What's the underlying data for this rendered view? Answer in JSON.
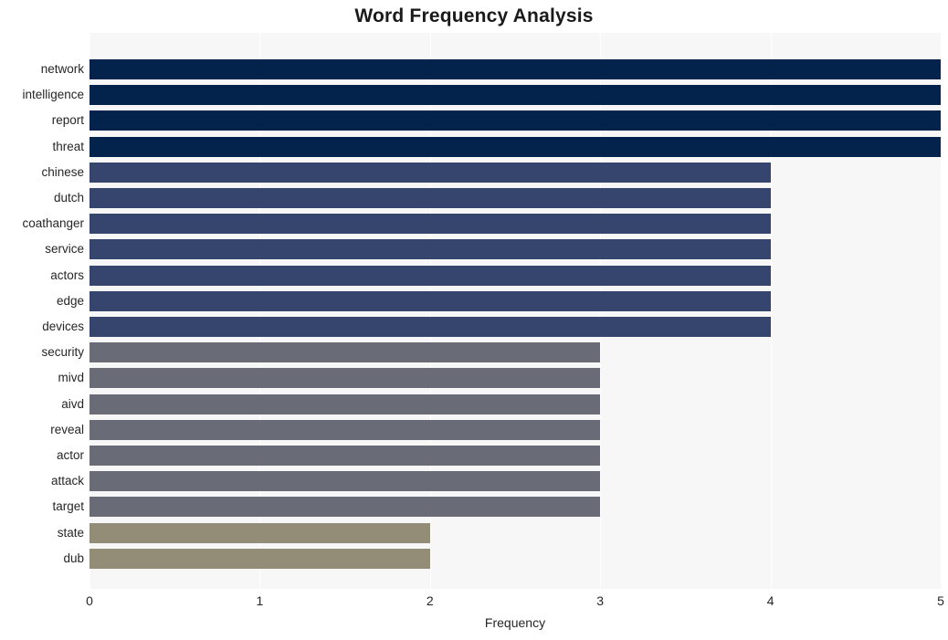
{
  "chart_data": {
    "type": "bar",
    "orientation": "horizontal",
    "title": "Word Frequency Analysis",
    "xlabel": "Frequency",
    "ylabel": "",
    "xlim": [
      0,
      5
    ],
    "xticks": [
      0,
      1,
      2,
      3,
      4,
      5
    ],
    "xtick_labels": [
      "0",
      "1",
      "2",
      "3",
      "4",
      "5"
    ],
    "grid": true,
    "grid_axis": "x",
    "legend": false,
    "background": "#f7f7f7",
    "categories": [
      "network",
      "intelligence",
      "report",
      "threat",
      "chinese",
      "dutch",
      "coathanger",
      "service",
      "actors",
      "edge",
      "devices",
      "security",
      "mivd",
      "aivd",
      "reveal",
      "actor",
      "attack",
      "target",
      "state",
      "dub"
    ],
    "values": [
      5,
      5,
      5,
      5,
      4,
      4,
      4,
      4,
      4,
      4,
      4,
      3,
      3,
      3,
      3,
      3,
      3,
      3,
      2,
      2
    ],
    "bar_colors": [
      "#03224c",
      "#03224c",
      "#03224c",
      "#03224c",
      "#36456e",
      "#36456e",
      "#36456e",
      "#36456e",
      "#36456e",
      "#36456e",
      "#36456e",
      "#696c77",
      "#696c77",
      "#696c77",
      "#696c77",
      "#696c77",
      "#696c77",
      "#696c77",
      "#938d78",
      "#938d78"
    ]
  }
}
